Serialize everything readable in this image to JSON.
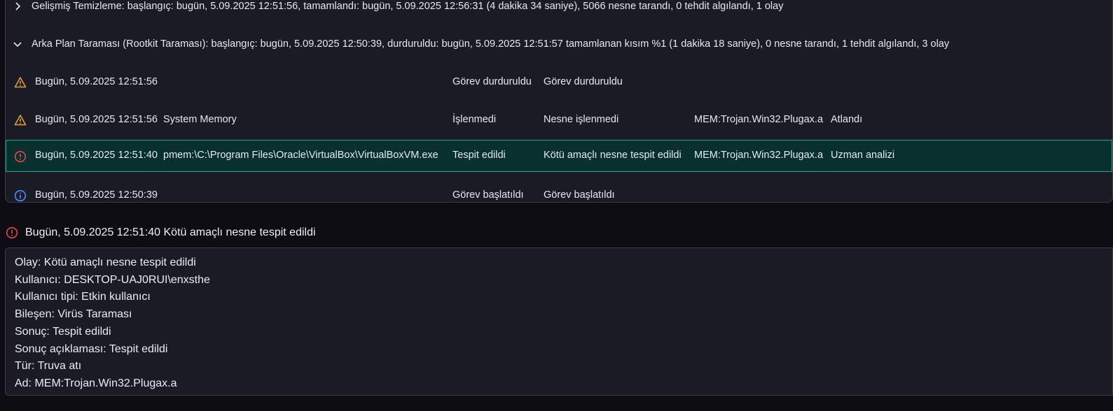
{
  "groups": [
    {
      "expanded": false,
      "text": "Gelişmiş Temizleme: başlangıç: bugün, 5.09.2025 12:51:56, tamamlandı: bugün, 5.09.2025 12:56:31 (4 dakika 34 saniye), 5066 nesne tarandı, 0 tehdit algılandı, 1 olay"
    },
    {
      "expanded": true,
      "text": "Arka Plan Taraması (Rootkit Taraması): başlangıç: bugün, 5.09.2025 12:50:39, durduruldu: bugün, 5.09.2025 12:51:57 tamamlanan kısım %1 (1 dakika 18 saniye), 0 nesne tarandı, 1 tehdit algılandı, 3 olay"
    }
  ],
  "events": [
    {
      "icon": "warning-icon",
      "time": "Bugün, 5.09.2025 12:51:56",
      "object": "",
      "result": "Görev durduruldu",
      "description": "Görev durduruldu",
      "detection": "",
      "action": ""
    },
    {
      "icon": "warning-icon",
      "time": "Bugün, 5.09.2025 12:51:56",
      "object": "System Memory",
      "result": "İşlenmedi",
      "description": "Nesne işlenmedi",
      "detection": "MEM:Trojan.Win32.Plugax.a",
      "action": "Atlandı"
    },
    {
      "icon": "error-icon",
      "time": "Bugün, 5.09.2025 12:51:40",
      "object": "pmem:\\C:\\Program Files\\Oracle\\VirtualBox\\VirtualBoxVM.exe",
      "result": "Tespit edildi",
      "description": "Kötü amaçlı nesne tespit edildi",
      "detection": "MEM:Trojan.Win32.Plugax.a",
      "action": "Uzman analizi"
    },
    {
      "icon": "info-icon",
      "time": "Bugün, 5.09.2025 12:50:39",
      "object": "",
      "result": "Görev başlatıldı",
      "description": "Görev başlatıldı",
      "detection": "",
      "action": ""
    }
  ],
  "detail": {
    "icon": "error-icon",
    "title": "Bugün, 5.09.2025 12:51:40 Kötü amaçlı nesne tespit edildi",
    "lines": [
      "Olay: Kötü amaçlı nesne tespit edildi",
      "Kullanıcı: DESKTOP-UAJ0RUI\\enxsthe",
      "Kullanıcı tipi: Etkin kullanıcı",
      "Bileşen: Virüs Taraması",
      "Sonuç: Tespit edildi",
      "Sonuç açıklaması: Tespit edildi",
      "Tür: Truva atı",
      "Ad: MEM:Trojan.Win32.Plugax.a"
    ]
  },
  "colors": {
    "background": "#0d0d13",
    "panel": "#1b1b25",
    "selected_bg": "#07302f",
    "selected_border": "#1aa394",
    "warning": "#e0a23a",
    "error": "#e5484d",
    "info": "#4c8dff"
  }
}
